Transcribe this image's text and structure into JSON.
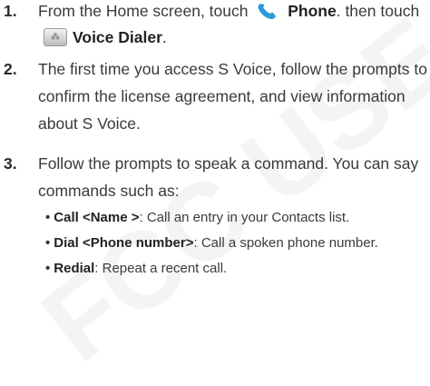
{
  "steps": [
    {
      "num": "1.",
      "part1": "From the Home screen, touch",
      "phone_label": "Phone",
      "part2": ". then touch",
      "dialer_label": "Voice Dialer",
      "end": "."
    },
    {
      "num": "2.",
      "line1": "The first time you access S Voice, follow the prompts to",
      "line2": "confirm the license agreement, and view information",
      "line3": "about S Voice."
    },
    {
      "num": "3.",
      "line1": "Follow the prompts to speak a command. You can say",
      "line2": "commands such as:"
    }
  ],
  "bullets": [
    {
      "cmd": "Call <Name >",
      "desc": ": Call an entry in your Contacts list."
    },
    {
      "cmd": "Dial <Phone number>",
      "desc": ": Call a spoken phone number."
    },
    {
      "cmd": "Redial",
      "desc": ": Repeat a recent call."
    }
  ],
  "bullet_char": "•",
  "icons": {
    "phone": "phone-handset-icon",
    "dialer": "voice-dialer-icon"
  },
  "colors": {
    "phone_icon": "#2a9bd6",
    "text": "#3a3a3a"
  }
}
